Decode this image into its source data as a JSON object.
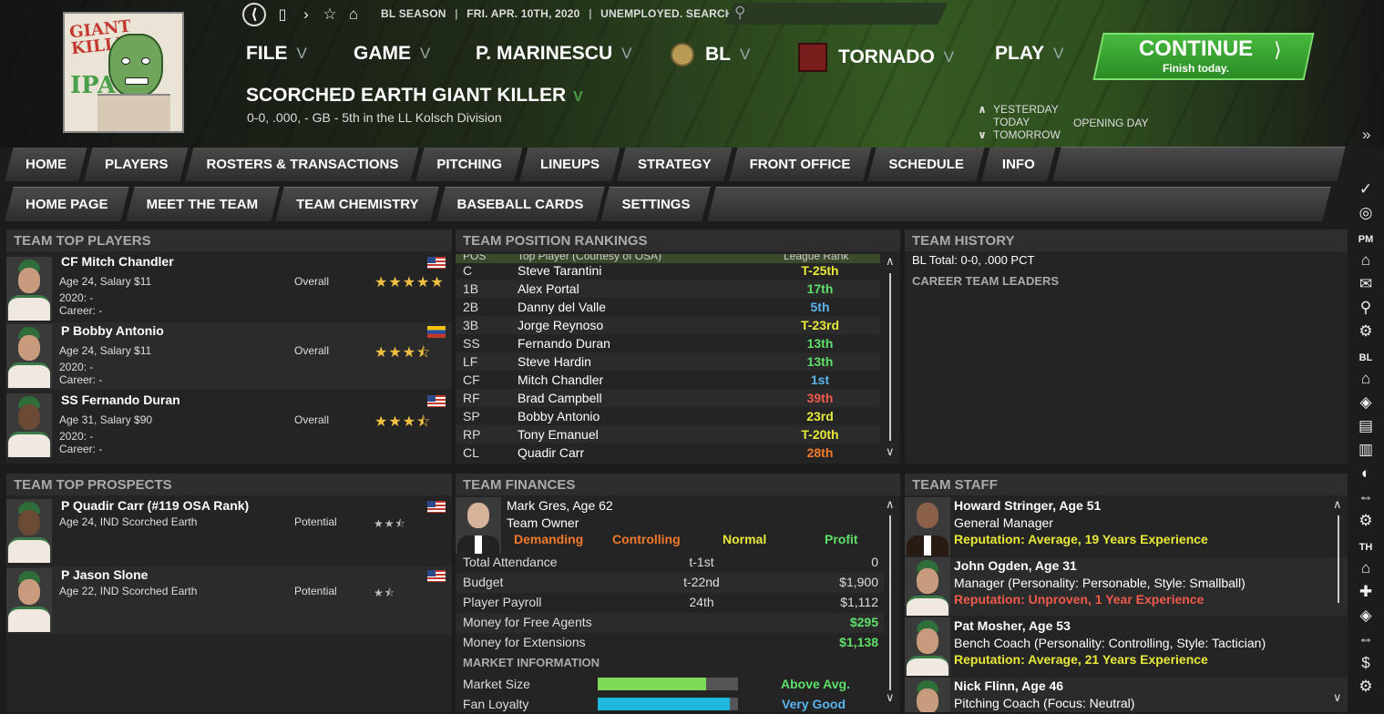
{
  "nav": {
    "season": "BL SEASON",
    "date": "FRI. APR. 10TH, 2020",
    "status": "UNEMPLOYED. SEARCH JOBS...",
    "menus": [
      "FILE",
      "GAME",
      "P. MARINESCU",
      "BL",
      "TORNADO",
      "PLAY"
    ],
    "continue_title": "CONTINUE",
    "continue_sub": "Finish today.",
    "team_name": "SCORCHED EARTH GIANT KILLER",
    "record": "0-0, .000, - GB - 5th in the LL Kolsch Division",
    "days": [
      "YESTERDAY",
      "TODAY",
      "TOMORROW"
    ],
    "today_event": "OPENING DAY",
    "logo_text_top": "GIANT KILLER",
    "logo_text_bottom": "IPA"
  },
  "tabs": [
    "HOME",
    "PLAYERS",
    "ROSTERS & TRANSACTIONS",
    "PITCHING",
    "LINEUPS",
    "STRATEGY",
    "FRONT OFFICE",
    "SCHEDULE",
    "INFO"
  ],
  "subtabs": [
    "HOME PAGE",
    "MEET THE TEAM",
    "TEAM CHEMISTRY",
    "BASEBALL CARDS",
    "SETTINGS"
  ],
  "top_players": {
    "title": "TEAM TOP PLAYERS",
    "label": "Overall",
    "players": [
      {
        "name": "CF Mitch Chandler",
        "info": "Age 24, Salary $11",
        "season": "2020: -",
        "career": "Career: -",
        "stars": "★★★★★"
      },
      {
        "name": "P Bobby Antonio",
        "info": "Age 24, Salary $11",
        "season": "2020: -",
        "career": "Career: -",
        "stars": "★★★⯪"
      },
      {
        "name": "SS Fernando Duran",
        "info": "Age 31, Salary $90",
        "season": "2020: -",
        "career": "Career: -",
        "stars": "★★★⯪"
      }
    ]
  },
  "top_prospects": {
    "title": "TEAM TOP PROSPECTS",
    "label": "Potential",
    "players": [
      {
        "name": "P Quadir Carr (#119 OSA Rank)",
        "info": "Age 24, IND Scorched Earth",
        "stars": "★★⯪"
      },
      {
        "name": "P Jason Slone",
        "info": "Age 22, IND Scorched Earth",
        "stars": "★⯪"
      }
    ]
  },
  "rankings": {
    "title": "TEAM POSITION RANKINGS",
    "col_pos": "POS",
    "col_player": "Top Player (Courtesy of OSA)",
    "col_rank": "League Rank",
    "rows": [
      {
        "pos": "C",
        "name": "Steve Tarantini",
        "rank": "T-25th",
        "color": "#e8e83a"
      },
      {
        "pos": "1B",
        "name": "Alex Portal",
        "rank": "17th",
        "color": "#5ee06a"
      },
      {
        "pos": "2B",
        "name": "Danny del Valle",
        "rank": "5th",
        "color": "#5ab4ee"
      },
      {
        "pos": "3B",
        "name": "Jorge Reynoso",
        "rank": "T-23rd",
        "color": "#e8e83a"
      },
      {
        "pos": "SS",
        "name": "Fernando Duran",
        "rank": "13th",
        "color": "#5ee06a"
      },
      {
        "pos": "LF",
        "name": "Steve Hardin",
        "rank": "13th",
        "color": "#5ee06a"
      },
      {
        "pos": "CF",
        "name": "Mitch Chandler",
        "rank": "1st",
        "color": "#5ab4ee"
      },
      {
        "pos": "RF",
        "name": "Brad Campbell",
        "rank": "39th",
        "color": "#f05a4a"
      },
      {
        "pos": "SP",
        "name": "Bobby Antonio",
        "rank": "23rd",
        "color": "#e8e83a"
      },
      {
        "pos": "RP",
        "name": "Tony Emanuel",
        "rank": "T-20th",
        "color": "#e8e83a"
      },
      {
        "pos": "CL",
        "name": "Quadir Carr",
        "rank": "28th",
        "color": "#f07a2a"
      }
    ]
  },
  "history": {
    "title": "TEAM HISTORY",
    "total": "BL Total: 0-0, .000 PCT",
    "leaders": "CAREER TEAM LEADERS"
  },
  "finances": {
    "title": "TEAM FINANCES",
    "owner_name": "Mark Gres, Age 62",
    "owner_role": "Team Owner",
    "traits": [
      {
        "text": "Demanding",
        "color": "#f07a2a"
      },
      {
        "text": "Controlling",
        "color": "#f07a2a"
      },
      {
        "text": "Normal",
        "color": "#e8e83a"
      },
      {
        "text": "Profit",
        "color": "#5ee06a"
      }
    ],
    "rows": [
      {
        "label": "Total Attendance",
        "rank": "t-1st",
        "value": "0",
        "color": "#ddd"
      },
      {
        "label": "Budget",
        "rank": "t-22nd",
        "value": "$1,900",
        "color": "#ddd"
      },
      {
        "label": "Player Payroll",
        "rank": "24th",
        "value": "$1,112",
        "color": "#ddd"
      },
      {
        "label": "Money for Free Agents",
        "rank": "",
        "value": "$295",
        "color": "#5ee06a"
      },
      {
        "label": "Money for Extensions",
        "rank": "",
        "value": "$1,138",
        "color": "#5ee06a"
      }
    ],
    "market_title": "MARKET INFORMATION",
    "market": [
      {
        "label": "Market Size",
        "value": "Above Avg.",
        "level": 0.77,
        "color": "#7ed957",
        "textcolor": "#5ee06a"
      },
      {
        "label": "Fan Loyalty",
        "value": "Very Good",
        "level": 0.94,
        "color": "#1fb7e0",
        "textcolor": "#5ab4ee"
      }
    ]
  },
  "staff": {
    "title": "TEAM STAFF",
    "members": [
      {
        "name": "Howard Stringer, Age 51",
        "role": "General Manager",
        "rep": "Reputation: Average, 19 Years Experience",
        "repcolor": "#e8e83a"
      },
      {
        "name": "John Ogden, Age 31",
        "role": "Manager (Personality: Personable, Style: Smallball)",
        "rep": "Reputation: Unproven, 1 Year Experience",
        "repcolor": "#f05a4a"
      },
      {
        "name": "Pat Mosher, Age 53",
        "role": "Bench Coach (Personality: Controlling, Style: Tactician)",
        "rep": "Reputation: Average, 21 Years Experience",
        "repcolor": "#e8e83a"
      },
      {
        "name": "Nick Flinn, Age 46",
        "role": "Pitching Coach (Focus: Neutral)",
        "rep": "",
        "repcolor": "#e8e83a"
      }
    ]
  },
  "side": {
    "labels": [
      "PM",
      "BL",
      "TH"
    ]
  }
}
